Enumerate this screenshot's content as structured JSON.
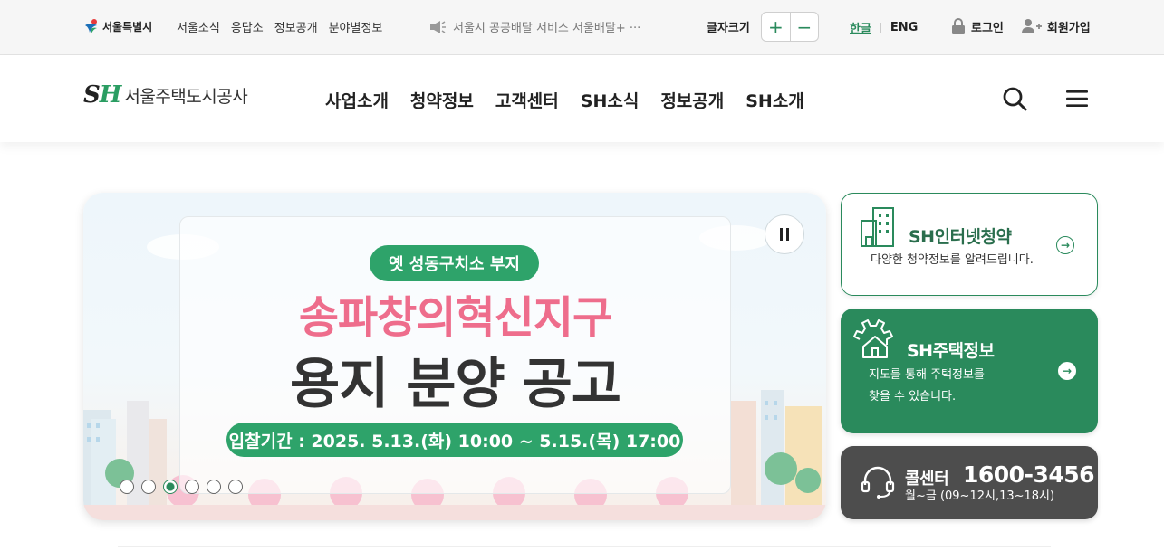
{
  "topbar": {
    "seoul_label": "서울특별시",
    "links": [
      "서울소식",
      "응답소",
      "정보공개",
      "분야별정보"
    ],
    "notice": "서울시 공공배달 서비스 서울배달+ ···",
    "fontsize_label": "글자크기",
    "fontsize_plus": "+",
    "fontsize_minus": "−",
    "lang_ko": "한글",
    "lang_en": "ENG",
    "login": "로그인",
    "signup": "회원가입"
  },
  "header": {
    "logo_mark_s": "S",
    "logo_mark_h": "H",
    "logo_name": "서울주택도시공사",
    "nav": [
      "사업소개",
      "청약정보",
      "고객센터",
      "SH소식",
      "정보공개",
      "SH소개"
    ]
  },
  "banner": {
    "badge": "옛 성동구치소 부지",
    "title1": "송파창의혁신지구",
    "title2": "용지 분양 공고",
    "period": "입찰기간 : 2025. 5.13.(화) 10:00 ~ 5.15.(목) 17:00",
    "slide_count": 6,
    "active_slide": 3
  },
  "side": {
    "cheongyak": {
      "title": "SH인터넷청약",
      "desc": "다양한 청약정보를 알려드립니다."
    },
    "housing": {
      "title": "SH주택정보",
      "desc_line1": "지도를 통해 주택정보를",
      "desc_line2": "찾을 수 있습니다."
    },
    "call": {
      "title": "콜센터",
      "number": "1600-3456",
      "hours": "월~금 (09~12시,13~18시)"
    }
  },
  "colors": {
    "brand_green": "#2a8a5c",
    "banner_green": "#2ea36a",
    "pink": "#ee6d8c",
    "dark_gray": "#4d4d4d"
  },
  "icons": [
    "seoul-logo-icon",
    "megaphone-icon",
    "lock-icon",
    "user-add-icon",
    "search-icon",
    "menu-icon",
    "pause-icon",
    "building-icon",
    "arrow-right-icon",
    "gear-house-icon",
    "headset-icon"
  ]
}
